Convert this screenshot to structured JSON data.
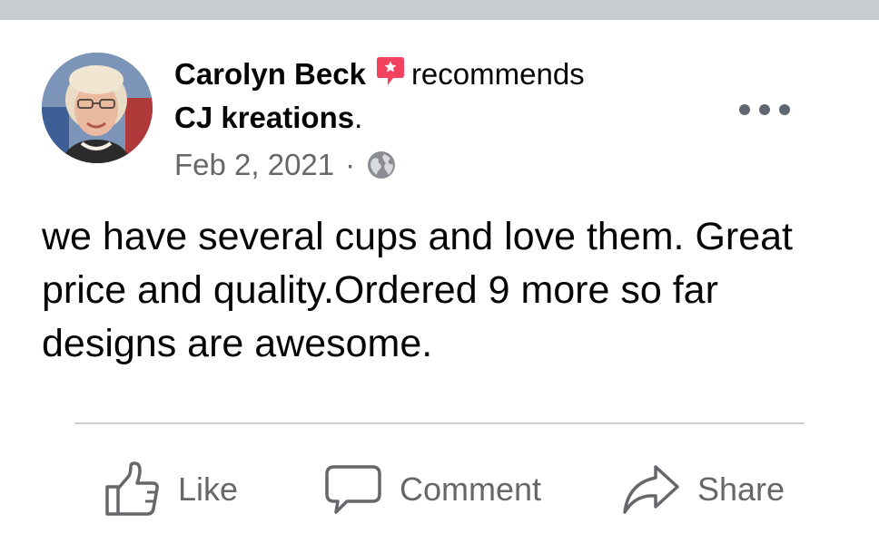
{
  "post": {
    "author": "Carolyn Beck",
    "action_text": "recommends",
    "page_name": "CJ kreations",
    "page_suffix": ".",
    "date": "Feb 2, 2021",
    "separator": "·",
    "privacy_icon": "globe-icon",
    "body": "we have several cups and love them. Great price and quality.Ordered 9 more so far designs are awesome."
  },
  "actions": {
    "like_label": "Like",
    "comment_label": "Comment",
    "share_label": "Share"
  },
  "icons": {
    "recommend": "recommend-badge-icon",
    "more": "more-options-icon",
    "like": "thumbs-up-icon",
    "comment": "speech-bubble-icon",
    "share": "share-arrow-icon"
  },
  "colors": {
    "recommend_badge": "#f3425f",
    "secondary_text": "#65676b",
    "primary_text": "#050505",
    "divider": "#ced0d4",
    "top_strip": "#c9ccd1"
  }
}
